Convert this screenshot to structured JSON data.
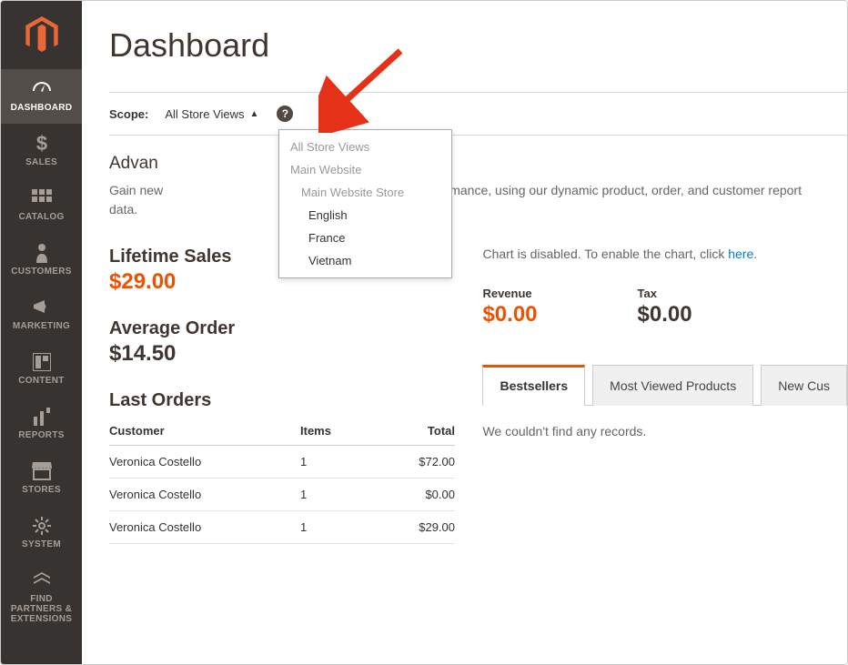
{
  "sidebar": {
    "items": [
      {
        "label": "DASHBOARD",
        "icon": "dashboard-icon",
        "active": true
      },
      {
        "label": "SALES",
        "icon": "sales-icon"
      },
      {
        "label": "CATALOG",
        "icon": "catalog-icon"
      },
      {
        "label": "CUSTOMERS",
        "icon": "customers-icon"
      },
      {
        "label": "MARKETING",
        "icon": "marketing-icon"
      },
      {
        "label": "CONTENT",
        "icon": "content-icon"
      },
      {
        "label": "REPORTS",
        "icon": "reports-icon"
      },
      {
        "label": "STORES",
        "icon": "stores-icon"
      },
      {
        "label": "SYSTEM",
        "icon": "system-icon"
      },
      {
        "label": "FIND PARTNERS & EXTENSIONS",
        "icon": "partners-icon"
      }
    ]
  },
  "page": {
    "title": "Dashboard"
  },
  "scope": {
    "label": "Scope:",
    "selected": "All Store Views",
    "options": [
      {
        "label": "All Store Views",
        "level": 0
      },
      {
        "label": "Main Website",
        "level": 1
      },
      {
        "label": "Main Website Store",
        "level": 2
      },
      {
        "label": "English",
        "level": 3
      },
      {
        "label": "France",
        "level": 3
      },
      {
        "label": "Vietnam",
        "level": 3
      }
    ],
    "help": "?"
  },
  "advanced": {
    "title_prefix": "Advan",
    "body_prefix": "Gain new",
    "body_suffix": "f your business' performance, using our dynamic product, order, and customer report",
    "body_end": "data."
  },
  "lifetime": {
    "title": "Lifetime Sales",
    "value": "$29.00"
  },
  "average": {
    "title": "Average Order",
    "value": "$14.50"
  },
  "last_orders": {
    "title": "Last Orders",
    "columns": {
      "customer": "Customer",
      "items": "Items",
      "total": "Total"
    },
    "rows": [
      {
        "customer": "Veronica Costello",
        "items": "1",
        "total": "$72.00"
      },
      {
        "customer": "Veronica Costello",
        "items": "1",
        "total": "$0.00"
      },
      {
        "customer": "Veronica Costello",
        "items": "1",
        "total": "$29.00"
      }
    ]
  },
  "chart": {
    "disabled_msg": "Chart is disabled. To enable the chart, click ",
    "link": "here",
    "period": "."
  },
  "kpi": {
    "revenue": {
      "label": "Revenue",
      "value": "$0.00"
    },
    "tax": {
      "label": "Tax",
      "value": "$0.00"
    }
  },
  "tabs": {
    "items": [
      "Bestsellers",
      "Most Viewed Products",
      "New Cus"
    ],
    "active": 0,
    "empty_msg": "We couldn't find any records."
  }
}
